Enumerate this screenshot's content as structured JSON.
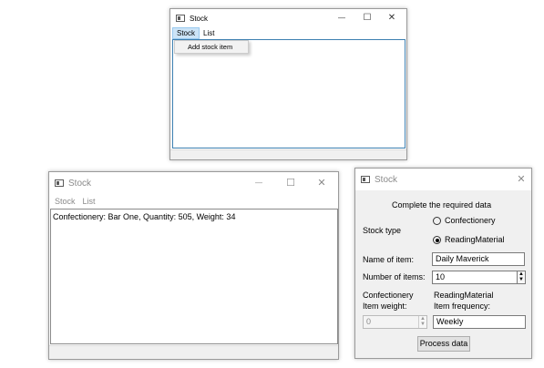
{
  "window1": {
    "title": "Stock",
    "menu": [
      "Stock",
      "List"
    ],
    "dropdown_item": "Add stock item",
    "minimize": "—",
    "maximize": "☐",
    "close": "✕"
  },
  "window2": {
    "title": "Stock",
    "menu": [
      "Stock",
      "List"
    ],
    "content_line": "Confectionery: Bar One, Quantity: 505, Weight: 34",
    "minimize": "—",
    "maximize": "☐",
    "close": "✕"
  },
  "dialog": {
    "title": "Stock",
    "close": "✕",
    "heading": "Complete the required data",
    "stock_type_label": "Stock type",
    "radio_confectionery": "Confectionery",
    "radio_reading": "ReadingMaterial",
    "name_label": "Name of item:",
    "name_value": "Daily Maverick",
    "number_label": "Number of items:",
    "number_value": "10",
    "conf_label_line1": "Confectionery",
    "conf_label_line2": "Item weight:",
    "reading_label_line1": "ReadingMaterial",
    "reading_label_line2": "Item frequency:",
    "weight_value": "0",
    "frequency_value": "Weekly",
    "process_button": "Process data"
  }
}
